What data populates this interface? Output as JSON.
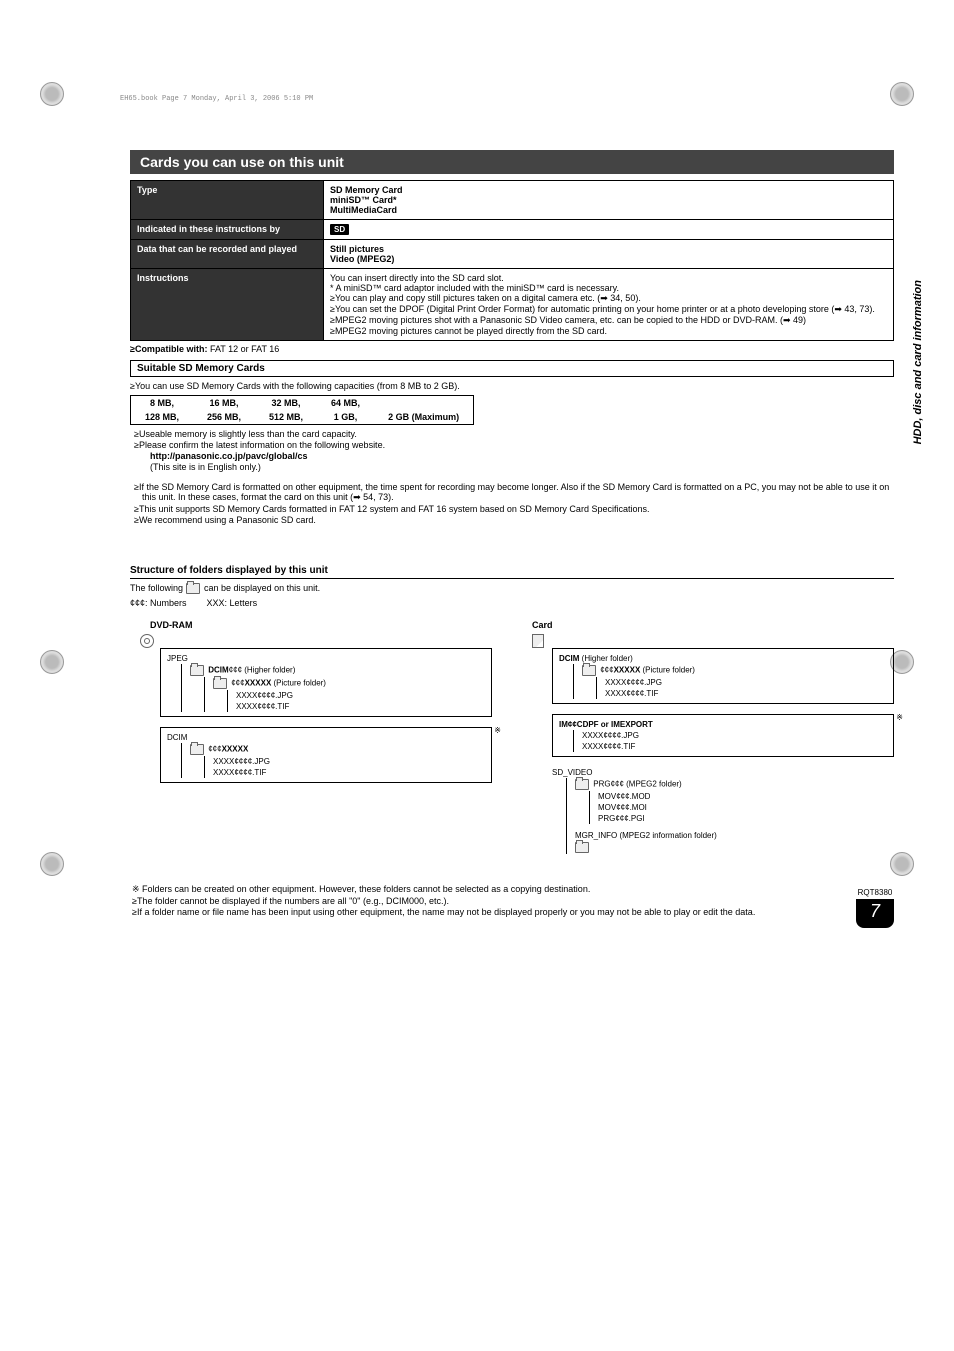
{
  "booktag": "EH65.book  Page 7  Monday, April 3, 2006  5:10 PM",
  "side_label": "HDD, disc and card information",
  "section_title": "Cards you can use on this unit",
  "spec_table": {
    "rows": [
      {
        "head": "Type",
        "body_lines": [
          "SD Memory Card",
          "miniSD™ Card*",
          "MultiMediaCard"
        ]
      },
      {
        "head": "Indicated in these instructions by",
        "badge": "SD"
      },
      {
        "head": "Data that can be recorded and played",
        "body_lines": [
          "Still pictures",
          "Video (MPEG2)"
        ]
      },
      {
        "head": "Instructions",
        "body_lines": [
          "You can insert directly into the SD card slot.",
          "* A miniSD™ card adaptor included with the miniSD™ card is necessary.",
          "≥You can play and copy still pictures taken on a digital camera etc. (➡ 34, 50).",
          "≥You can set the DPOF (Digital Print Order Format) for automatic printing on your home printer or at a photo developing store (➡ 43, 73).",
          "≥MPEG2 moving pictures shot with a Panasonic SD Video camera, etc. can be copied to the HDD or DVD-RAM. (➡ 49)",
          "≥MPEG2 moving pictures cannot be played directly from the SD card."
        ]
      }
    ]
  },
  "compat_line": "≥Compatible with: ",
  "compat_val": "FAT 12 or FAT 16",
  "suitable_title": "Suitable SD Memory Cards",
  "suitable_intro": "≥You can use SD Memory Cards with the following capacities (from 8 MB to 2 GB).",
  "cap_row1": [
    "8 MB,",
    "16 MB,",
    "32 MB,",
    "64 MB,",
    ""
  ],
  "cap_row2": [
    "128 MB,",
    "256 MB,",
    "512 MB,",
    "1 GB,",
    "2 GB (Maximum)"
  ],
  "bullets1": [
    "≥Useable memory is slightly less than the card capacity.",
    "≥Please confirm the latest information on the following website."
  ],
  "url_line": "http://panasonic.co.jp/pavc/global/cs",
  "url_note": "(This site is in English only.)",
  "bullets2": [
    "≥If the SD Memory Card is formatted on other equipment, the time spent for recording may become longer. Also if the SD Memory Card is formatted on a PC, you may not be able to use it on this unit. In these cases, format the card on this unit (➡ 54, 73).",
    "≥This unit supports SD Memory Cards formatted in FAT 12 system and FAT 16 system based on SD Memory Card Specifications.",
    "≥We recommend using a Panasonic SD card."
  ],
  "struct_title": "Structure of folders displayed by this unit",
  "struct_intro_pre": "The following ",
  "struct_intro_post": " can be displayed on this unit.",
  "legend_a": "¢¢¢: Numbers",
  "legend_b": "XXX: Letters",
  "dvd_label": "DVD-RAM",
  "card_label": "Card",
  "dvd_box1": {
    "l1": "JPEG",
    "l2a": "DCIM",
    "l2b": "¢¢¢ (Higher folder)",
    "l3a": "¢¢¢",
    "l3b": "XXXXX",
    "l3c": " (Picture folder)",
    "l4": "XXXX¢¢¢¢.JPG",
    "l5": "XXXX¢¢¢¢.TIF"
  },
  "dvd_box2": {
    "l1": "DCIM",
    "l2a": "¢¢¢",
    "l2b": "XXXXX",
    "l3": "XXXX¢¢¢¢.JPG",
    "l4": "XXXX¢¢¢¢.TIF"
  },
  "card_box1": {
    "l1a": "DCIM",
    "l1b": " (Higher folder)",
    "l2a": "¢¢¢",
    "l2b": "XXXXX",
    "l2c": " (Picture folder)",
    "l3": "XXXX¢¢¢¢.JPG",
    "l4": "XXXX¢¢¢¢.TIF"
  },
  "card_box2": {
    "l1": "IM¢¢CDPF or IMEXPORT",
    "l2": "XXXX¢¢¢¢.JPG",
    "l3": "XXXX¢¢¢¢.TIF"
  },
  "card_sd": {
    "l1": "SD_VIDEO",
    "l2a": "PRG¢¢¢",
    "l2b": " (MPEG2 folder)",
    "l3": "MOV¢¢¢.MOD",
    "l4": "MOV¢¢¢.MOI",
    "l5": "PRG¢¢¢.PGI",
    "l6a": "MGR_INFO",
    "l6b": " (MPEG2 information folder)"
  },
  "star_note": "※",
  "footer": [
    "※ Folders can be created on other equipment. However, these folders cannot be selected as a copying destination.",
    "≥The folder cannot be displayed if the numbers are all \"0\" (e.g., DCIM000, etc.).",
    "≥If a folder name or file name has been input using other equipment, the name may not be displayed properly or you may not be able to play or edit the data."
  ],
  "page_code": "RQT8380",
  "page_num": "7"
}
